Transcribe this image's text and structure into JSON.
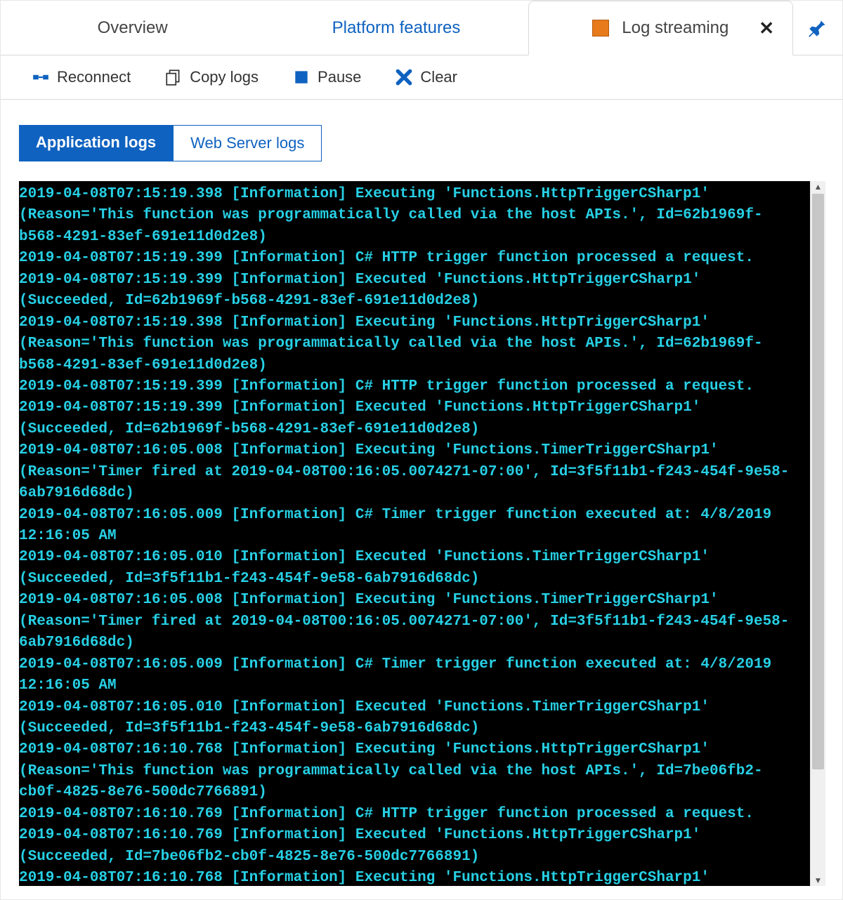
{
  "tabs": {
    "overview": "Overview",
    "platform_features": "Platform features",
    "log_streaming": "Log streaming"
  },
  "toolbar": {
    "reconnect": "Reconnect",
    "copy_logs": "Copy logs",
    "pause": "Pause",
    "clear": "Clear"
  },
  "log_type_tabs": {
    "application": "Application logs",
    "web_server": "Web Server logs"
  },
  "log_lines": [
    "2019-04-08T07:15:19.398 [Information] Executing 'Functions.HttpTriggerCSharp1' (Reason='This function was programmatically called via the host APIs.', Id=62b1969f-b568-4291-83ef-691e11d0d2e8)",
    "2019-04-08T07:15:19.399 [Information] C# HTTP trigger function processed a request.",
    "2019-04-08T07:15:19.399 [Information] Executed 'Functions.HttpTriggerCSharp1' (Succeeded, Id=62b1969f-b568-4291-83ef-691e11d0d2e8)",
    "2019-04-08T07:15:19.398 [Information] Executing 'Functions.HttpTriggerCSharp1' (Reason='This function was programmatically called via the host APIs.', Id=62b1969f-b568-4291-83ef-691e11d0d2e8)",
    "2019-04-08T07:15:19.399 [Information] C# HTTP trigger function processed a request.",
    "2019-04-08T07:15:19.399 [Information] Executed 'Functions.HttpTriggerCSharp1' (Succeeded, Id=62b1969f-b568-4291-83ef-691e11d0d2e8)",
    "2019-04-08T07:16:05.008 [Information] Executing 'Functions.TimerTriggerCSharp1' (Reason='Timer fired at 2019-04-08T00:16:05.0074271-07:00', Id=3f5f11b1-f243-454f-9e58-6ab7916d68dc)",
    "2019-04-08T07:16:05.009 [Information] C# Timer trigger function executed at: 4/8/2019 12:16:05 AM",
    "2019-04-08T07:16:05.010 [Information] Executed 'Functions.TimerTriggerCSharp1' (Succeeded, Id=3f5f11b1-f243-454f-9e58-6ab7916d68dc)",
    "2019-04-08T07:16:05.008 [Information] Executing 'Functions.TimerTriggerCSharp1' (Reason='Timer fired at 2019-04-08T00:16:05.0074271-07:00', Id=3f5f11b1-f243-454f-9e58-6ab7916d68dc)",
    "2019-04-08T07:16:05.009 [Information] C# Timer trigger function executed at: 4/8/2019 12:16:05 AM",
    "2019-04-08T07:16:05.010 [Information] Executed 'Functions.TimerTriggerCSharp1' (Succeeded, Id=3f5f11b1-f243-454f-9e58-6ab7916d68dc)",
    "2019-04-08T07:16:10.768 [Information] Executing 'Functions.HttpTriggerCSharp1' (Reason='This function was programmatically called via the host APIs.', Id=7be06fb2-cb0f-4825-8e76-500dc7766891)",
    "2019-04-08T07:16:10.769 [Information] C# HTTP trigger function processed a request.",
    "2019-04-08T07:16:10.769 [Information] Executed 'Functions.HttpTriggerCSharp1' (Succeeded, Id=7be06fb2-cb0f-4825-8e76-500dc7766891)",
    "2019-04-08T07:16:10.768 [Information] Executing 'Functions.HttpTriggerCSharp1'"
  ]
}
